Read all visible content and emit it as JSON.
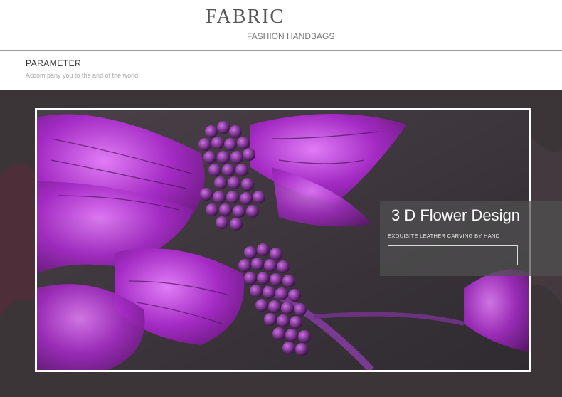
{
  "header": {
    "title": "FABRIC",
    "subtitle": "FASHION HANDBAGS"
  },
  "section": {
    "title": "PARAMETER",
    "subtitle": "Accom pany you to the and of the world"
  },
  "feature": {
    "title": "3 D Flower Design",
    "subtitle": "EXQUISITE LEATHER CARVING BY HAND",
    "input_value": ""
  },
  "colors": {
    "petal": "#a42bc4",
    "petal_light": "#d86af0",
    "leather": "#3f3a40",
    "panel": "#505050"
  }
}
